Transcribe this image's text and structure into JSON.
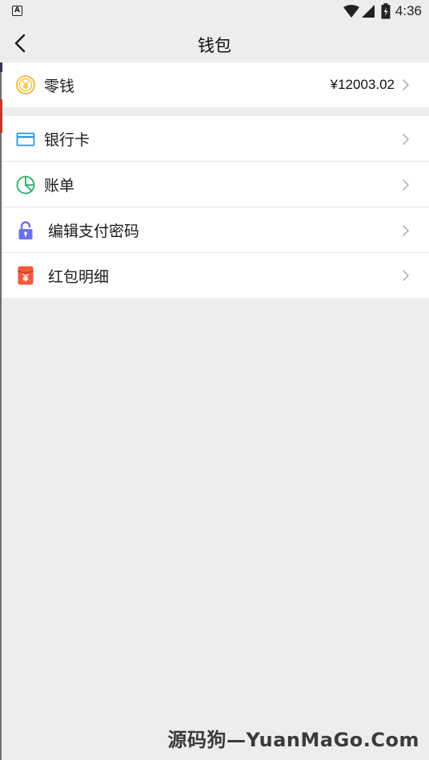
{
  "status_bar": {
    "notification_letter": "A",
    "time": "4:36",
    "icons": [
      "wifi-icon",
      "cellular-signal-icon",
      "battery-icon"
    ]
  },
  "header": {
    "title": "钱包",
    "back_icon": "chevron-left-icon"
  },
  "balance_section": {
    "label": "零钱",
    "value": "¥12003.02",
    "icon": "yuan-coin-icon",
    "icon_color": "#f5b82e"
  },
  "menu": {
    "items": [
      {
        "label": "银行卡",
        "icon": "bank-card-icon",
        "icon_color": "#2f95e0"
      },
      {
        "label": "账单",
        "icon": "pie-chart-icon",
        "icon_color": "#2aae67"
      },
      {
        "label": "编辑支付密码",
        "icon": "unlock-icon",
        "icon_color": "#6b6ff0"
      },
      {
        "label": "红包明细",
        "icon": "red-envelope-icon",
        "icon_color": "#f25a3c"
      }
    ]
  },
  "watermark": "源码狗—YuanMaGo.Com",
  "colors": {
    "background": "#ededed",
    "surface": "#ffffff",
    "divider": "#e6e6e6",
    "chevron": "#b3b3b3"
  }
}
